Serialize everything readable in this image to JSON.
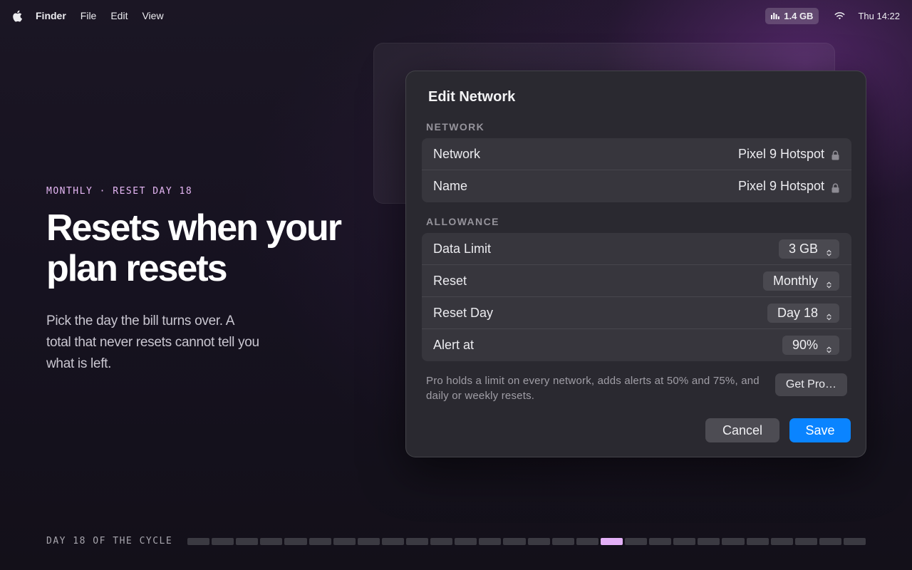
{
  "menubar": {
    "app_name": "Finder",
    "menus": [
      "File",
      "Edit",
      "View"
    ],
    "data_usage": "1.4 GB",
    "clock": "Thu 14:22",
    "icons": [
      "apple-icon",
      "bar-chart-icon",
      "wifi-icon"
    ]
  },
  "hero": {
    "eyebrow": "MONTHLY · RESET DAY 18",
    "headline": "Resets when your plan resets",
    "body": "Pick the day the bill turns over. A total that never resets cannot tell you what is left."
  },
  "dialog": {
    "title": "Edit Network",
    "network_section": {
      "label": "NETWORK",
      "rows": [
        {
          "label": "Network",
          "value": "Pixel 9 Hotspot"
        },
        {
          "label": "Name",
          "value": "Pixel 9 Hotspot"
        }
      ]
    },
    "allowance_section": {
      "label": "ALLOWANCE",
      "rows": [
        {
          "label": "Data Limit",
          "value": "3 GB"
        },
        {
          "label": "Reset",
          "value": "Monthly"
        },
        {
          "label": "Reset Day",
          "value": "Day 18"
        },
        {
          "label": "Alert at",
          "value": "90%"
        }
      ]
    },
    "pro_note": "Pro holds a limit on every network, adds alerts at 50% and 75%, and daily or weekly resets.",
    "get_pro_label": "Get Pro…",
    "cancel_label": "Cancel",
    "save_label": "Save"
  },
  "cycle": {
    "label": "DAY 18 OF THE CYCLE",
    "current_day": 18,
    "total_days": 28
  },
  "colors": {
    "accent": "#0a84ff",
    "highlight": "#e3b0f7",
    "dialog_bg": "#2a2930"
  }
}
